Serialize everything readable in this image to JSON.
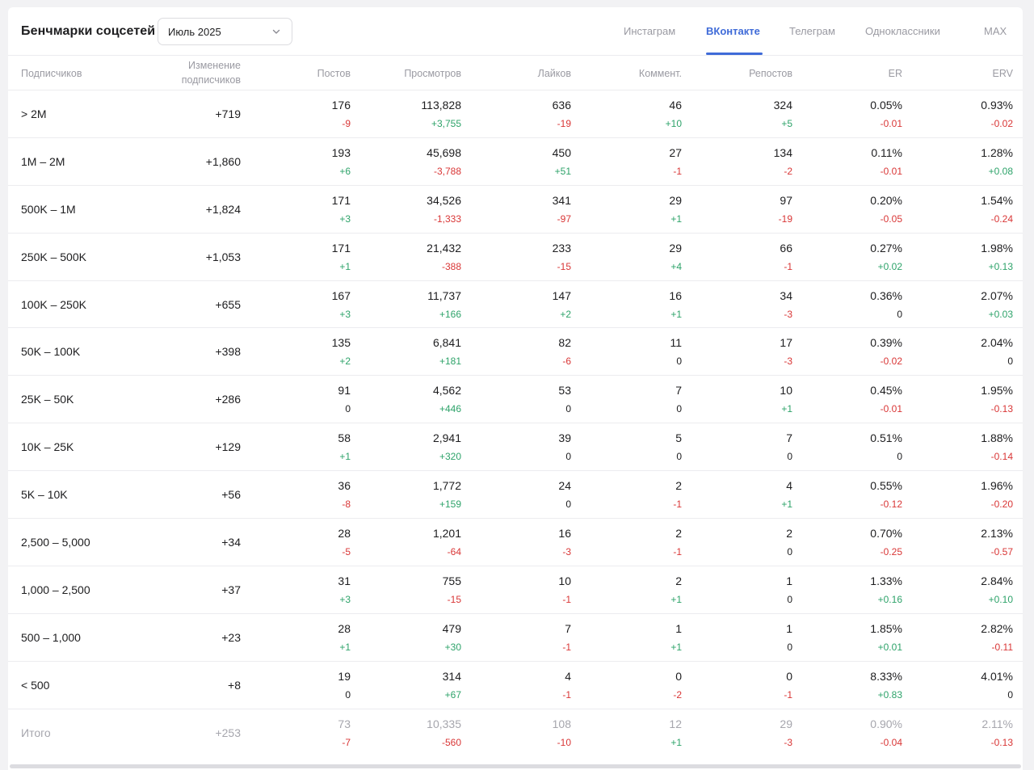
{
  "header": {
    "title": "Бенчмарки соцсетей",
    "period": "Июль 2025"
  },
  "tabs": [
    {
      "label": "Инстаграм",
      "active": false
    },
    {
      "label": "ВКонтакте",
      "active": true
    },
    {
      "label": "Телеграм",
      "active": false
    },
    {
      "label": "Одноклассники",
      "active": false
    },
    {
      "label": "MAX",
      "active": false
    }
  ],
  "columns": {
    "segment": "Подписчиков",
    "change": [
      "Изменение",
      "подписчиков"
    ],
    "posts": "Постов",
    "views": "Просмотров",
    "likes": "Лайков",
    "comments": "Коммент.",
    "reposts": "Репостов",
    "er": "ER",
    "erv": "ERV"
  },
  "rows": [
    {
      "segment": "> 2M",
      "change": "+719",
      "posts": [
        "176",
        "-9"
      ],
      "views": [
        "113,828",
        "+3,755"
      ],
      "likes": [
        "636",
        "-19"
      ],
      "comments": [
        "46",
        "+10"
      ],
      "reposts": [
        "324",
        "+5"
      ],
      "er": [
        "0.05%",
        "-0.01"
      ],
      "erv": [
        "0.93%",
        "-0.02"
      ]
    },
    {
      "segment": "1M – 2M",
      "change": "+1,860",
      "posts": [
        "193",
        "+6"
      ],
      "views": [
        "45,698",
        "-3,788"
      ],
      "likes": [
        "450",
        "+51"
      ],
      "comments": [
        "27",
        "-1"
      ],
      "reposts": [
        "134",
        "-2"
      ],
      "er": [
        "0.11%",
        "-0.01"
      ],
      "erv": [
        "1.28%",
        "+0.08"
      ]
    },
    {
      "segment": "500K – 1M",
      "change": "+1,824",
      "posts": [
        "171",
        "+3"
      ],
      "views": [
        "34,526",
        "-1,333"
      ],
      "likes": [
        "341",
        "-97"
      ],
      "comments": [
        "29",
        "+1"
      ],
      "reposts": [
        "97",
        "-19"
      ],
      "er": [
        "0.20%",
        "-0.05"
      ],
      "erv": [
        "1.54%",
        "-0.24"
      ]
    },
    {
      "segment": "250K – 500K",
      "change": "+1,053",
      "posts": [
        "171",
        "+1"
      ],
      "views": [
        "21,432",
        "-388"
      ],
      "likes": [
        "233",
        "-15"
      ],
      "comments": [
        "29",
        "+4"
      ],
      "reposts": [
        "66",
        "-1"
      ],
      "er": [
        "0.27%",
        "+0.02"
      ],
      "erv": [
        "1.98%",
        "+0.13"
      ]
    },
    {
      "segment": "100K – 250K",
      "change": "+655",
      "posts": [
        "167",
        "+3"
      ],
      "views": [
        "11,737",
        "+166"
      ],
      "likes": [
        "147",
        "+2"
      ],
      "comments": [
        "16",
        "+1"
      ],
      "reposts": [
        "34",
        "-3"
      ],
      "er": [
        "0.36%",
        "0"
      ],
      "erv": [
        "2.07%",
        "+0.03"
      ]
    },
    {
      "segment": "50K – 100K",
      "change": "+398",
      "posts": [
        "135",
        "+2"
      ],
      "views": [
        "6,841",
        "+181"
      ],
      "likes": [
        "82",
        "-6"
      ],
      "comments": [
        "11",
        "0"
      ],
      "reposts": [
        "17",
        "-3"
      ],
      "er": [
        "0.39%",
        "-0.02"
      ],
      "erv": [
        "2.04%",
        "0"
      ]
    },
    {
      "segment": "25K – 50K",
      "change": "+286",
      "posts": [
        "91",
        "0"
      ],
      "views": [
        "4,562",
        "+446"
      ],
      "likes": [
        "53",
        "0"
      ],
      "comments": [
        "7",
        "0"
      ],
      "reposts": [
        "10",
        "+1"
      ],
      "er": [
        "0.45%",
        "-0.01"
      ],
      "erv": [
        "1.95%",
        "-0.13"
      ]
    },
    {
      "segment": "10K – 25K",
      "change": "+129",
      "posts": [
        "58",
        "+1"
      ],
      "views": [
        "2,941",
        "+320"
      ],
      "likes": [
        "39",
        "0"
      ],
      "comments": [
        "5",
        "0"
      ],
      "reposts": [
        "7",
        "0"
      ],
      "er": [
        "0.51%",
        "0"
      ],
      "erv": [
        "1.88%",
        "-0.14"
      ]
    },
    {
      "segment": "5K – 10K",
      "change": "+56",
      "posts": [
        "36",
        "-8"
      ],
      "views": [
        "1,772",
        "+159"
      ],
      "likes": [
        "24",
        "0"
      ],
      "comments": [
        "2",
        "-1"
      ],
      "reposts": [
        "4",
        "+1"
      ],
      "er": [
        "0.55%",
        "-0.12"
      ],
      "erv": [
        "1.96%",
        "-0.20"
      ]
    },
    {
      "segment": "2,500 – 5,000",
      "change": "+34",
      "posts": [
        "28",
        "-5"
      ],
      "views": [
        "1,201",
        "-64"
      ],
      "likes": [
        "16",
        "-3"
      ],
      "comments": [
        "2",
        "-1"
      ],
      "reposts": [
        "2",
        "0"
      ],
      "er": [
        "0.70%",
        "-0.25"
      ],
      "erv": [
        "2.13%",
        "-0.57"
      ]
    },
    {
      "segment": "1,000 – 2,500",
      "change": "+37",
      "posts": [
        "31",
        "+3"
      ],
      "views": [
        "755",
        "-15"
      ],
      "likes": [
        "10",
        "-1"
      ],
      "comments": [
        "2",
        "+1"
      ],
      "reposts": [
        "1",
        "0"
      ],
      "er": [
        "1.33%",
        "+0.16"
      ],
      "erv": [
        "2.84%",
        "+0.10"
      ]
    },
    {
      "segment": "500 – 1,000",
      "change": "+23",
      "posts": [
        "28",
        "+1"
      ],
      "views": [
        "479",
        "+30"
      ],
      "likes": [
        "7",
        "-1"
      ],
      "comments": [
        "1",
        "+1"
      ],
      "reposts": [
        "1",
        "0"
      ],
      "er": [
        "1.85%",
        "+0.01"
      ],
      "erv": [
        "2.82%",
        "-0.11"
      ]
    },
    {
      "segment": "< 500",
      "change": "+8",
      "posts": [
        "19",
        "0"
      ],
      "views": [
        "314",
        "+67"
      ],
      "likes": [
        "4",
        "-1"
      ],
      "comments": [
        "0",
        "-2"
      ],
      "reposts": [
        "0",
        "-1"
      ],
      "er": [
        "8.33%",
        "+0.83"
      ],
      "erv": [
        "4.01%",
        "0"
      ]
    }
  ],
  "total": {
    "segment": "Итого",
    "change": "+253",
    "posts": [
      "73",
      "-7"
    ],
    "views": [
      "10,335",
      "-560"
    ],
    "likes": [
      "108",
      "-10"
    ],
    "comments": [
      "12",
      "+1"
    ],
    "reposts": [
      "29",
      "-3"
    ],
    "er": [
      "0.90%",
      "-0.04"
    ],
    "erv": [
      "2.11%",
      "-0.13"
    ]
  },
  "colors": {
    "accent": "#3f6bd8",
    "positive": "#2ea36a",
    "negative": "#d93636"
  }
}
